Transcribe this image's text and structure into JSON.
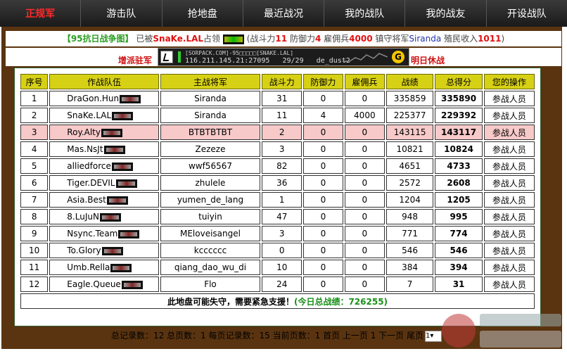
{
  "nav": [
    {
      "label": "正规军",
      "active": true
    },
    {
      "label": "游击队"
    },
    {
      "label": "抢地盘"
    },
    {
      "label": "最近战况"
    },
    {
      "label": "我的战队"
    },
    {
      "label": "我的战友"
    },
    {
      "label": "开设战队"
    }
  ],
  "info": {
    "bracket_open": "【",
    "land": "95抗日战争图",
    "bracket_close": "】",
    "was_by": "已被",
    "team": "SnaKe.LAL",
    "occupied": "占领",
    "paren_open": "(战斗力",
    "power": "11",
    "def_label": "防御力",
    "defense": "4",
    "merc_label": "雇佣兵",
    "mercs": "4000",
    "general_label": "镇守将军",
    "general": "Siranda",
    "income_label": "殖民收入",
    "income": "1011",
    "paren_close": ")"
  },
  "server": {
    "station_label": "增派驻军",
    "rest_label": "明日休战",
    "banner_title": "[SORPACK.COM]-95□□□□□[SNAKE.LAL]",
    "banner_addr": "116.211.145.21:27095",
    "banner_players": "29/29",
    "banner_map": "de_dust2",
    "banner_g": "G"
  },
  "table": {
    "headers": [
      "序号",
      "作战队伍",
      "主战将军",
      "战斗力",
      "防御力",
      "雇佣兵",
      "战绩",
      "总得分",
      "您的操作"
    ],
    "rows": [
      {
        "no": "1",
        "team": "DraGon.Hun",
        "general": "Siranda",
        "power": "31",
        "defense": "0",
        "mercs": "0",
        "record": "335859",
        "total": "335890",
        "op": "参战人员"
      },
      {
        "no": "2",
        "team": "SnaKe.LAL",
        "general": "Siranda",
        "power": "11",
        "defense": "4",
        "mercs": "4000",
        "record": "225377",
        "total": "229392",
        "op": "参战人员"
      },
      {
        "no": "3",
        "team": "Roy.Alty",
        "general": "BTBTBTBT",
        "power": "2",
        "defense": "0",
        "mercs": "0",
        "record": "143115",
        "total": "143117",
        "op": "参战人员",
        "highlight": true
      },
      {
        "no": "4",
        "team": "Mas.NsJt",
        "general": "Zezeze",
        "power": "3",
        "defense": "0",
        "mercs": "0",
        "record": "10821",
        "total": "10824",
        "op": "参战人员"
      },
      {
        "no": "5",
        "team": "alliedforce",
        "general": "wwf56567",
        "power": "82",
        "defense": "0",
        "mercs": "0",
        "record": "4651",
        "total": "4733",
        "op": "参战人员"
      },
      {
        "no": "6",
        "team": "Tiger.DEVIL",
        "general": "zhulele",
        "power": "36",
        "defense": "0",
        "mercs": "0",
        "record": "2572",
        "total": "2608",
        "op": "参战人员"
      },
      {
        "no": "7",
        "team": "Asia.Best",
        "general": "yumen_de_lang",
        "power": "1",
        "defense": "0",
        "mercs": "0",
        "record": "1204",
        "total": "1205",
        "op": "参战人员"
      },
      {
        "no": "8",
        "team": "8.LuJuN",
        "general": "tuiyin",
        "power": "47",
        "defense": "0",
        "mercs": "0",
        "record": "948",
        "total": "995",
        "op": "参战人员"
      },
      {
        "no": "9",
        "team": "Nsync.Team",
        "general": "MEloveisangel",
        "power": "3",
        "defense": "0",
        "mercs": "0",
        "record": "771",
        "total": "774",
        "op": "参战人员"
      },
      {
        "no": "10",
        "team": "To.Glory",
        "general": "kcccccc",
        "power": "0",
        "defense": "0",
        "mercs": "0",
        "record": "546",
        "total": "546",
        "op": "参战人员"
      },
      {
        "no": "11",
        "team": "Umb.Rella",
        "general": "qiang_dao_wu_di",
        "power": "10",
        "defense": "0",
        "mercs": "0",
        "record": "384",
        "total": "394",
        "op": "参战人员"
      },
      {
        "no": "12",
        "team": "Eagle.Queue",
        "general": "Flo",
        "power": "24",
        "defense": "0",
        "mercs": "0",
        "record": "7",
        "total": "31",
        "op": "参战人员"
      }
    ],
    "footer_alert": "此地盘可能失守，需要紧急支援！",
    "footer_today": "(今日总战绩：726255)"
  },
  "pager": {
    "text": "总记录数：12 总页数：1 每页记录数：15 当前页数：1 首页 上一页 1 下一页 尾页",
    "page_value": "1"
  },
  "colors": {
    "header_bg": "#d7d116",
    "frame": "#5a3410",
    "highlight_row": "#f7c9c9",
    "accent_red": "#e01010",
    "link_blue": "#2244aa"
  }
}
